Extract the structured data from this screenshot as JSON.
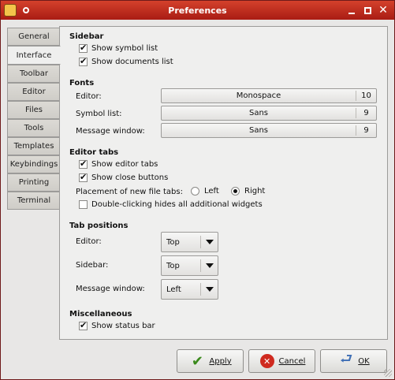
{
  "window": {
    "title": "Preferences"
  },
  "tabs": [
    "General",
    "Interface",
    "Toolbar",
    "Editor",
    "Files",
    "Tools",
    "Templates",
    "Keybindings",
    "Printing",
    "Terminal"
  ],
  "active_tab": "Interface",
  "sidebar": {
    "heading": "Sidebar",
    "show_symbol_list": {
      "label": "Show symbol list",
      "checked": true
    },
    "show_documents_list": {
      "label": "Show documents list",
      "checked": true
    }
  },
  "fonts": {
    "heading": "Fonts",
    "editor": {
      "label": "Editor:",
      "font": "Monospace",
      "size": "10"
    },
    "symbol_list": {
      "label": "Symbol list:",
      "font": "Sans",
      "size": "9"
    },
    "message_window": {
      "label": "Message window:",
      "font": "Sans",
      "size": "9"
    }
  },
  "editor_tabs": {
    "heading": "Editor tabs",
    "show_editor_tabs": {
      "label": "Show editor tabs",
      "checked": true
    },
    "show_close_buttons": {
      "label": "Show close buttons",
      "checked": true
    },
    "placement_label": "Placement of new file tabs:",
    "left_label": "Left",
    "right_label": "Right",
    "placement": "Right",
    "double_click": {
      "label": "Double-clicking hides all additional widgets",
      "checked": false
    }
  },
  "tab_positions": {
    "heading": "Tab positions",
    "editor": {
      "label": "Editor:",
      "value": "Top"
    },
    "sidebar": {
      "label": "Sidebar:",
      "value": "Top"
    },
    "message_window": {
      "label": "Message window:",
      "value": "Left"
    }
  },
  "misc": {
    "heading": "Miscellaneous",
    "show_status_bar": {
      "label": "Show status bar",
      "checked": true
    }
  },
  "buttons": {
    "apply": "Apply",
    "cancel": "Cancel",
    "ok": "OK"
  }
}
